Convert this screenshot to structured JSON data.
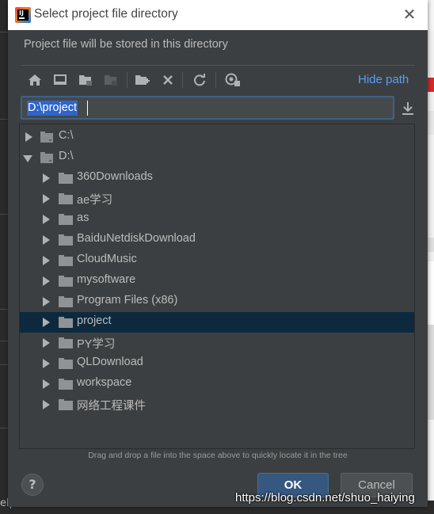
{
  "dialog": {
    "title": "Select project file directory",
    "subtitle": "Project file will be stored in this directory",
    "hide_path_label": "Hide path",
    "path_value": "D:\\project",
    "hint": "Drag and drop a file into the space above to quickly locate it in the tree",
    "help_label": "?",
    "ok_label": "OK",
    "cancel_label": "Cancel"
  },
  "toolbar": {
    "icons": [
      "home-icon",
      "desktop-icon",
      "project-folder-icon",
      "module-folder-icon",
      "new-folder-icon",
      "delete-icon",
      "refresh-icon",
      "show-hidden-icon"
    ]
  },
  "tree": {
    "roots": [
      {
        "label": "C:\\",
        "expanded": false
      },
      {
        "label": "D:\\",
        "expanded": true
      }
    ],
    "children": [
      {
        "label": "360Downloads"
      },
      {
        "label": "ae学习"
      },
      {
        "label": "as"
      },
      {
        "label": "BaiduNetdiskDownload"
      },
      {
        "label": "CloudMusic"
      },
      {
        "label": "mysoftware"
      },
      {
        "label": "Program Files (x86)"
      },
      {
        "label": "project",
        "selected": true
      },
      {
        "label": "PY学习"
      },
      {
        "label": "QLDownload"
      },
      {
        "label": "workspace"
      },
      {
        "label": "网络工程课件"
      }
    ]
  },
  "background": {
    "bottom_left_text": "elp",
    "watermark": "https://blog.csdn.net/shuo_haiying"
  },
  "colors": {
    "dialog_bg": "#3c3f41",
    "selection_bg": "#0d293e",
    "link_blue": "#589df6",
    "ok_blue": "#365880",
    "text": "#bbbbbb"
  }
}
